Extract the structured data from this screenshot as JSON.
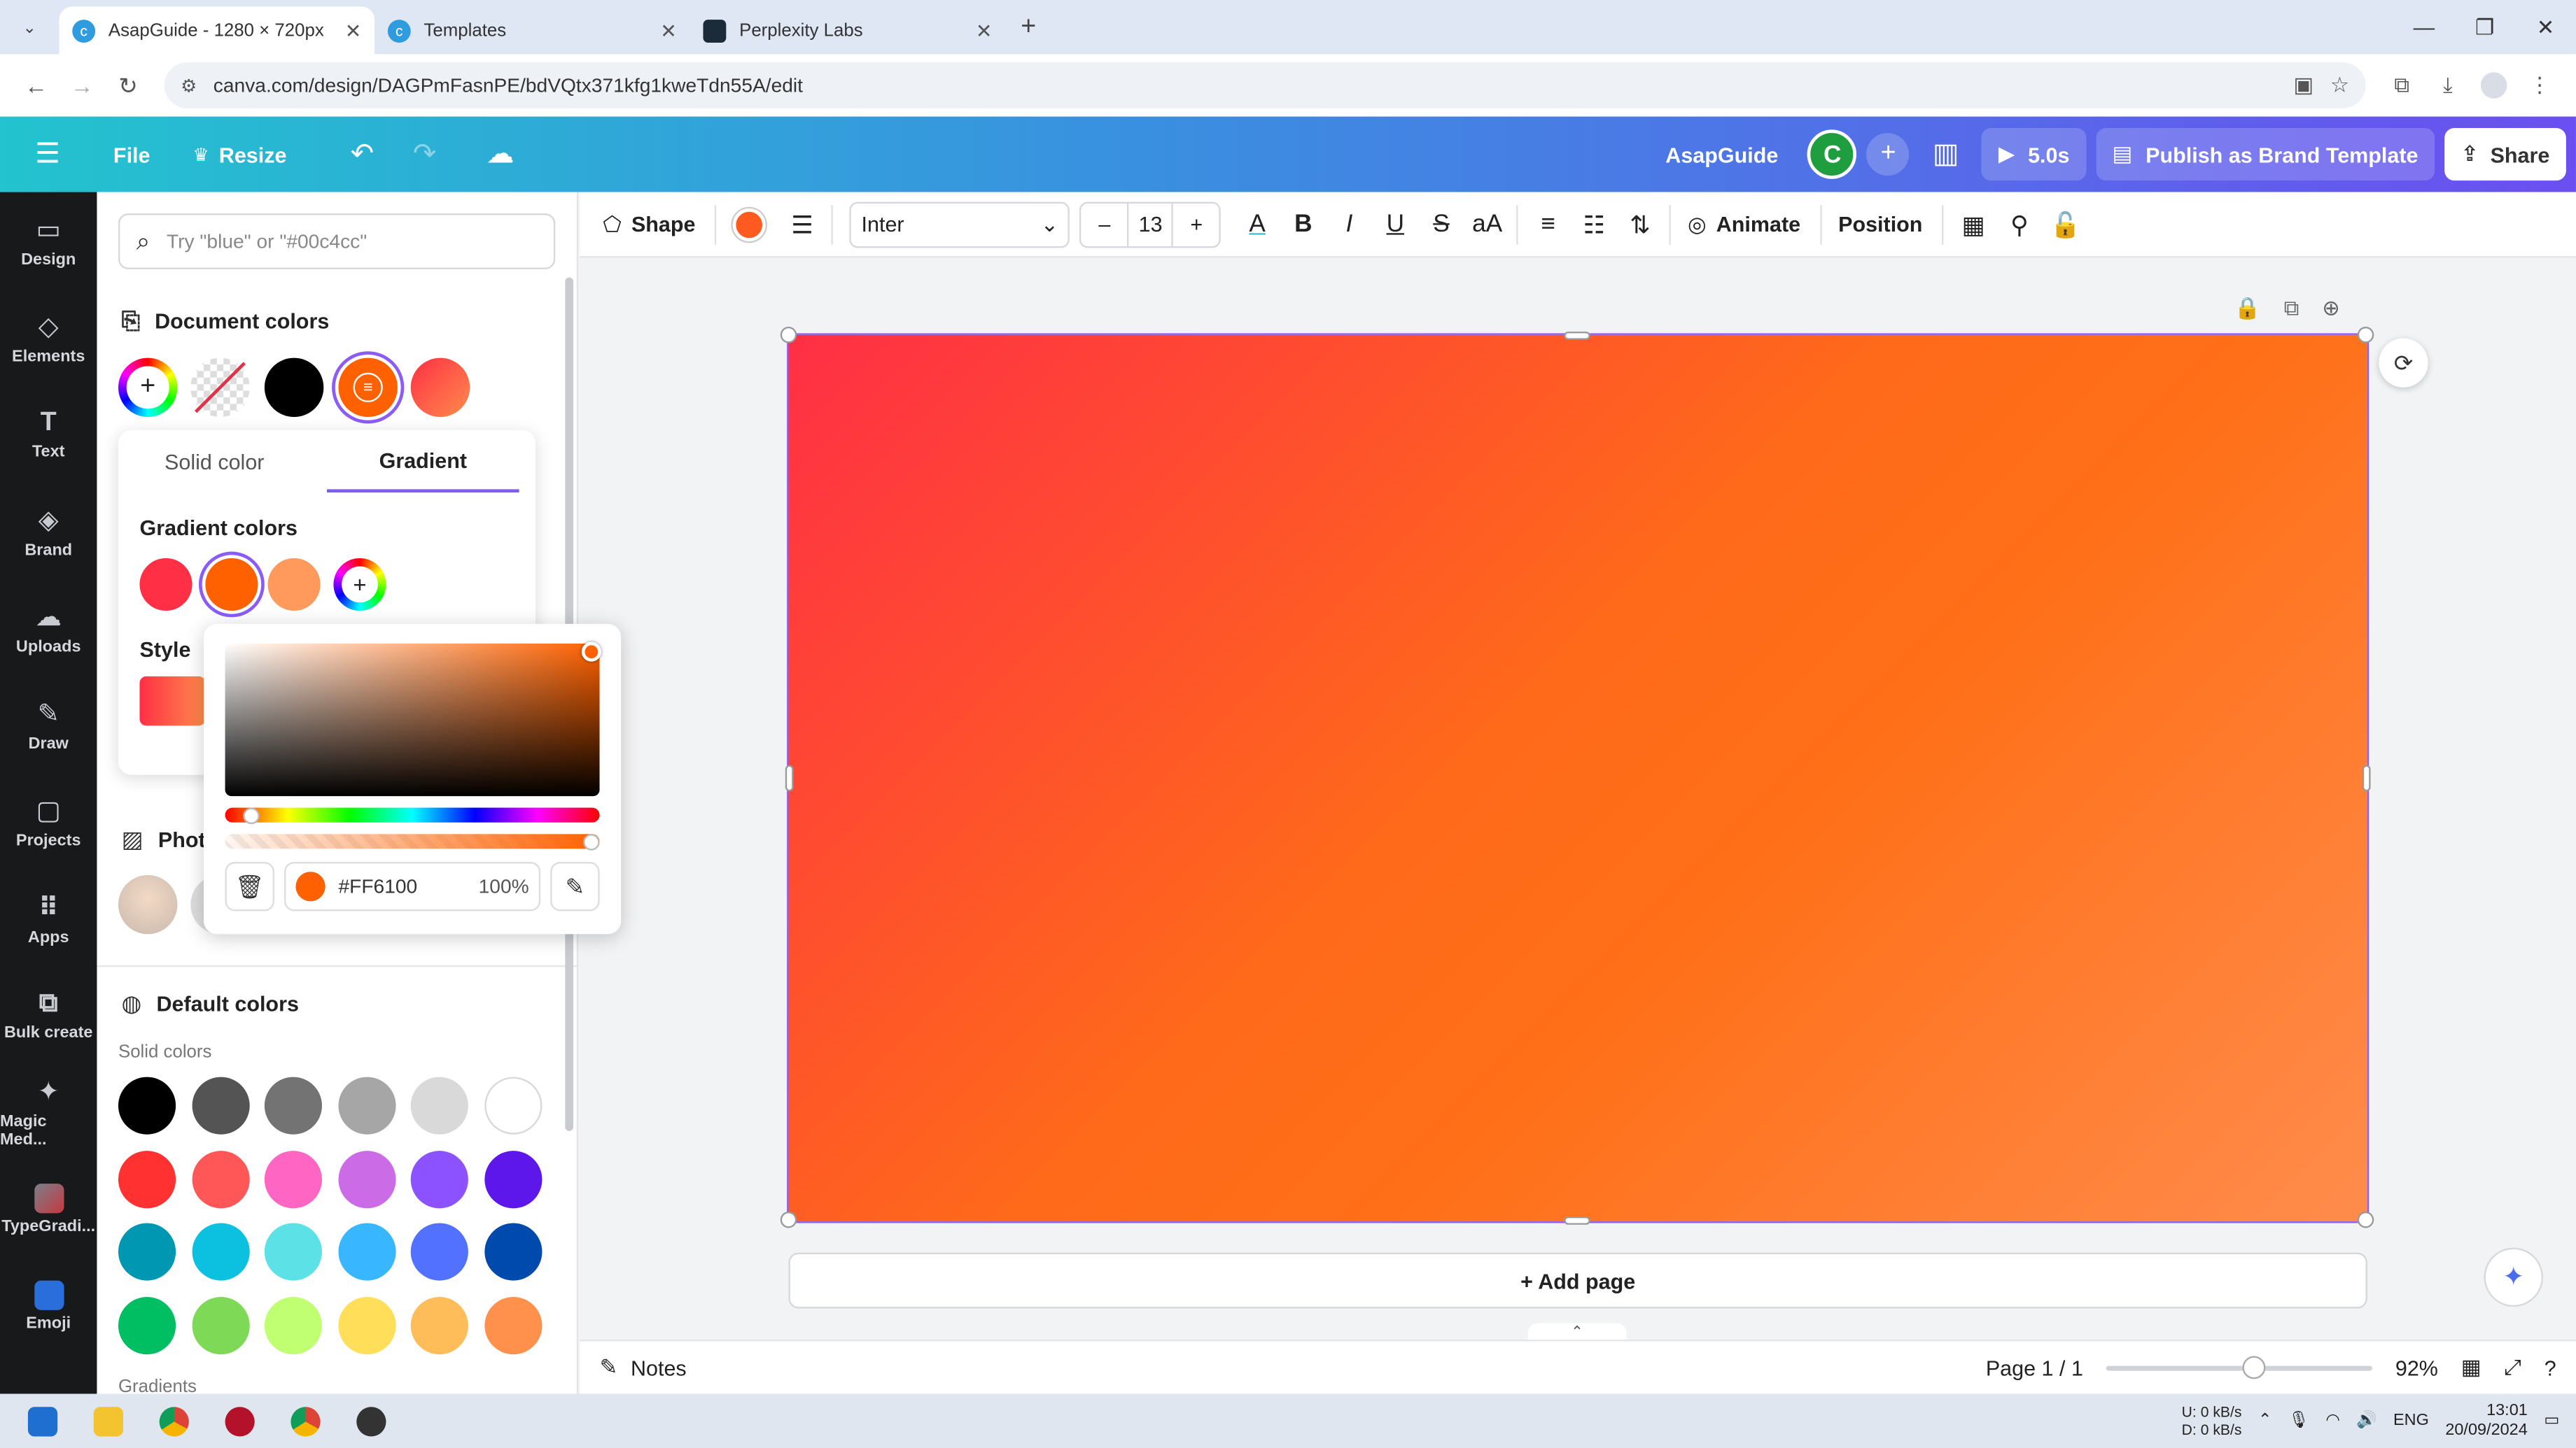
{
  "browser": {
    "tabs": [
      {
        "title": "AsapGuide - 1280 × 720px",
        "active": true
      },
      {
        "title": "Templates",
        "active": false
      },
      {
        "title": "Perplexity Labs",
        "active": false
      }
    ],
    "url": "canva.com/design/DAGPmFasnPE/bdVQtx371kfg1kweTdn55A/edit"
  },
  "header": {
    "file_label": "File",
    "resize_label": "Resize",
    "project_name": "AsapGuide",
    "avatar_letter": "C",
    "timer_label": "5.0s",
    "publish_label": "Publish as Brand Template",
    "share_label": "Share"
  },
  "rail": {
    "items": [
      {
        "label": "Design",
        "icon": "design-icon"
      },
      {
        "label": "Elements",
        "icon": "elements-icon"
      },
      {
        "label": "Text",
        "icon": "text-icon"
      },
      {
        "label": "Brand",
        "icon": "brand-icon"
      },
      {
        "label": "Uploads",
        "icon": "uploads-icon"
      },
      {
        "label": "Draw",
        "icon": "draw-icon"
      },
      {
        "label": "Projects",
        "icon": "projects-icon"
      },
      {
        "label": "Apps",
        "icon": "apps-icon"
      },
      {
        "label": "Bulk create",
        "icon": "bulk-create-icon"
      },
      {
        "label": "Magic Med...",
        "icon": "magic-media-icon"
      },
      {
        "label": "TypeGradi...",
        "icon": "typegradient-icon"
      },
      {
        "label": "Emoji",
        "icon": "emoji-icon"
      }
    ]
  },
  "panel": {
    "search_placeholder": "Try \"blue\" or \"#00c4cc\"",
    "document_colors_title": "Document colors",
    "photo_colors_title": "Phot",
    "default_colors_title": "Default colors",
    "solid_colors_label": "Solid colors",
    "gradients_label": "Gradients",
    "document_colors": [
      "#000000",
      "#ff6100"
    ],
    "solid_colors": [
      "#000000",
      "#545454",
      "#737373",
      "#a6a6a6",
      "#d9d9d9",
      "#ffffff",
      "#ff3131",
      "#ff5757",
      "#ff66c4",
      "#cb6ce6",
      "#8c52ff",
      "#5e17eb",
      "#0097b2",
      "#0cc0df",
      "#5ce1e6",
      "#38b6ff",
      "#5271ff",
      "#004aad",
      "#00bf63",
      "#7ed957",
      "#c1ff72",
      "#ffde59",
      "#ffbd59",
      "#ff914d"
    ]
  },
  "gradient_popover": {
    "tab_solid": "Solid color",
    "tab_gradient": "Gradient",
    "gradient_colors_title": "Gradient colors",
    "style_title": "Style",
    "gradient_stops": [
      "#ff2f45",
      "#ff6100",
      "#ff9a5c"
    ]
  },
  "color_picker": {
    "hex": "#FF6100",
    "opacity": "100%",
    "hue_fraction": 0.05,
    "alpha_fraction": 1.0
  },
  "context_toolbar": {
    "shape_label": "Shape",
    "font_name": "Inter",
    "font_size": "13",
    "animate_label": "Animate",
    "position_label": "Position"
  },
  "canvas": {
    "add_page_label": "+ Add page"
  },
  "bottombar": {
    "notes_label": "Notes",
    "page_indicator": "Page 1 / 1",
    "zoom": "92%"
  },
  "taskbar": {
    "net_up": "0 kB/s",
    "net_down": "0 kB/s",
    "lang": "ENG",
    "time": "13:01",
    "date": "20/09/2024"
  }
}
